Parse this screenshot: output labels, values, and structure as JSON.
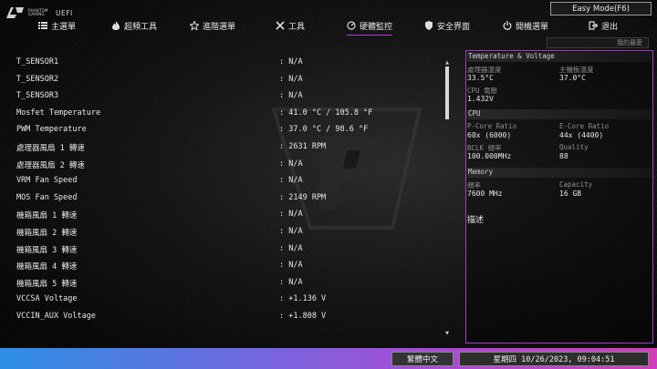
{
  "brand": {
    "line1": "PHANTOM",
    "line2": "GAMING",
    "product": "UEFI"
  },
  "easy_mode_label": "Easy Mode(F6)",
  "tabs": [
    {
      "label": "主選單",
      "icon": "list-icon"
    },
    {
      "label": "超頻工具",
      "icon": "flame-icon"
    },
    {
      "label": "進階選單",
      "icon": "star-icon"
    },
    {
      "label": "工具",
      "icon": "tools-icon"
    },
    {
      "label": "硬體監控",
      "icon": "monitor-icon"
    },
    {
      "label": "安全界面",
      "icon": "shield-icon"
    },
    {
      "label": "開機選單",
      "icon": "power-icon"
    },
    {
      "label": "退出",
      "icon": "exit-icon"
    }
  ],
  "active_tab": "硬體監控",
  "favorites_label": "我的最愛",
  "monitor_rows": [
    {
      "label": "T_SENSOR1",
      "value": ": N/A"
    },
    {
      "label": "T_SENSOR2",
      "value": ": N/A"
    },
    {
      "label": "T_SENSOR3",
      "value": ": N/A"
    },
    {
      "label": "Mosfet Temperature",
      "value": ": 41.0 °C / 105.8 °F"
    },
    {
      "label": "PWM Temperature",
      "value": ": 37.0 °C /  98.6 °F"
    },
    {
      "label": "處理器風扇 1 轉速",
      "value": ": 2631 RPM"
    },
    {
      "label": "處理器風扇 2 轉速",
      "value": ": N/A"
    },
    {
      "label": "VRM Fan Speed",
      "value": ": N/A"
    },
    {
      "label": "MOS Fan Speed",
      "value": ": 2149 RPM"
    },
    {
      "label": "機箱風扇 1 轉速",
      "value": ": N/A"
    },
    {
      "label": "機箱風扇 2 轉速",
      "value": ": N/A"
    },
    {
      "label": "機箱風扇 3 轉速",
      "value": ": N/A"
    },
    {
      "label": "機箱風扇 4 轉速",
      "value": ": N/A"
    },
    {
      "label": "機箱風扇 5 轉速",
      "value": ": N/A"
    },
    {
      "label": "VCCSA Voltage",
      "value": ": +1.136 V"
    },
    {
      "label": "VCCIN_AUX Voltage",
      "value": ": +1.808 V"
    }
  ],
  "panel": {
    "temp_title": "Temperature & Voltage",
    "cpu_temp_label": "處理器溫度",
    "cpu_temp": "33.5°C",
    "mb_temp_label": "主機板溫度",
    "mb_temp": "37.0°C",
    "cpu_vcore_label": "CPU 電壓",
    "cpu_vcore": "1.432V",
    "cpu_title": "CPU",
    "pcore_label": "P-Core Ratio",
    "pcore": "60x (6000)",
    "ecore_label": "E-Core Ratio",
    "ecore": "44x (4400)",
    "bclk_label": "BCLK 頻率",
    "bclk": "100.000MHz",
    "quality_label": "Quality",
    "quality": "88",
    "mem_title": "Memory",
    "freq_label": "頻率",
    "freq": "7600 MHz",
    "cap_label": "Capacity",
    "cap": "16 GB",
    "desc_title": "描述"
  },
  "footer": {
    "language": "繁體中文",
    "datetime": "星期四 10/26/2023, 09:04:51"
  },
  "colors": {
    "accent": "#b03bd0",
    "footer_left": "#2d8fe6",
    "footer_right": "#d03fb8"
  }
}
